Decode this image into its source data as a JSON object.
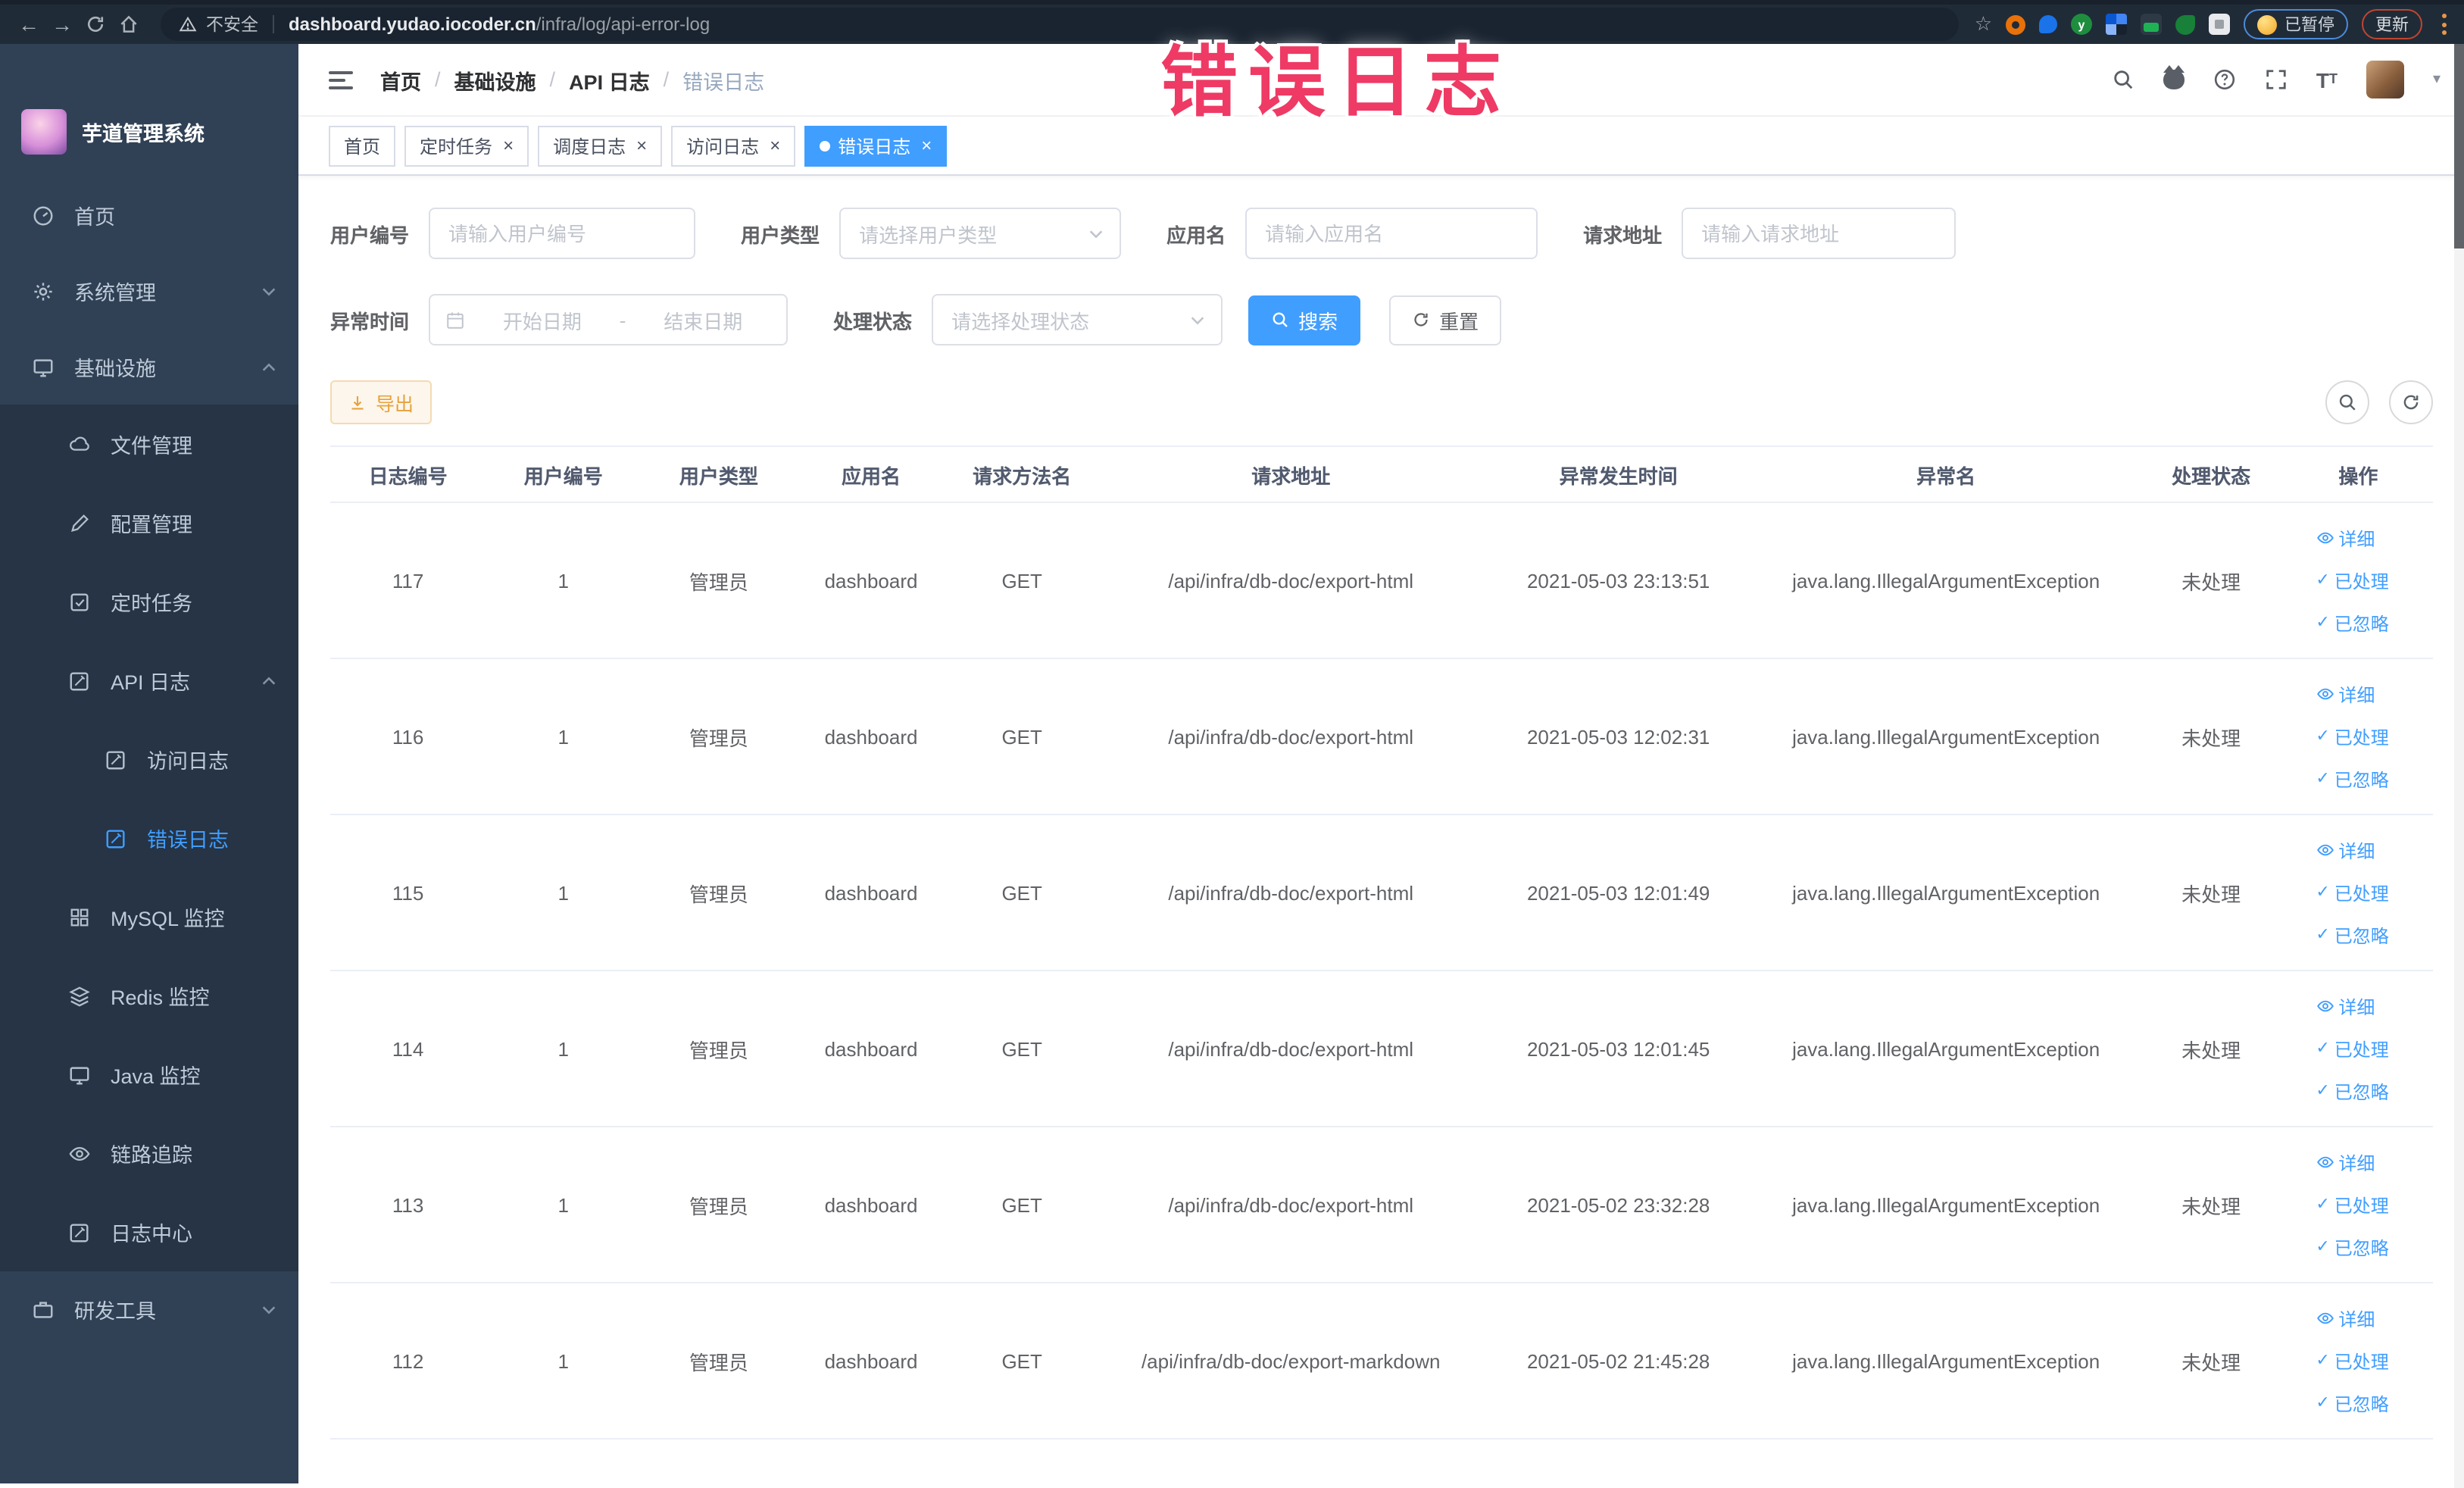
{
  "annotation": {
    "text": "错误日志"
  },
  "browser": {
    "security_label": "不安全",
    "url_host": "dashboard.yudao.iocoder.cn",
    "url_path": "/infra/log/api-error-log",
    "paused_button": "已暂停",
    "update_button": "更新"
  },
  "sidebar": {
    "title": "芋道管理系统",
    "items": [
      {
        "label": "首页"
      },
      {
        "label": "系统管理"
      },
      {
        "label": "基础设施"
      },
      {
        "label": "文件管理"
      },
      {
        "label": "配置管理"
      },
      {
        "label": "定时任务"
      },
      {
        "label": "API 日志"
      },
      {
        "label": "访问日志"
      },
      {
        "label": "错误日志",
        "active": true
      },
      {
        "label": "MySQL 监控"
      },
      {
        "label": "Redis 监控"
      },
      {
        "label": "Java 监控"
      },
      {
        "label": "链路追踪"
      },
      {
        "label": "日志中心"
      },
      {
        "label": "研发工具"
      }
    ]
  },
  "header": {
    "breadcrumb": [
      "首页",
      "基础设施",
      "API 日志",
      "错误日志"
    ]
  },
  "tabs": [
    {
      "label": "首页",
      "closable": false,
      "active": false
    },
    {
      "label": "定时任务",
      "closable": true,
      "active": false
    },
    {
      "label": "调度日志",
      "closable": true,
      "active": false
    },
    {
      "label": "访问日志",
      "closable": true,
      "active": false
    },
    {
      "label": "错误日志",
      "closable": true,
      "active": true
    }
  ],
  "filters": {
    "user_id": {
      "label": "用户编号",
      "placeholder": "请输入用户编号"
    },
    "user_type": {
      "label": "用户类型",
      "placeholder": "请选择用户类型"
    },
    "app_name": {
      "label": "应用名",
      "placeholder": "请输入应用名"
    },
    "request_url": {
      "label": "请求地址",
      "placeholder": "请输入请求地址"
    },
    "exception_time": {
      "label": "异常时间",
      "start_placeholder": "开始日期",
      "separator": "-",
      "end_placeholder": "结束日期"
    },
    "process_status": {
      "label": "处理状态",
      "placeholder": "请选择处理状态"
    },
    "search_button": "搜索",
    "reset_button": "重置"
  },
  "toolbar": {
    "export_button": "导出"
  },
  "table": {
    "columns": [
      "日志编号",
      "用户编号",
      "用户类型",
      "应用名",
      "请求方法名",
      "请求地址",
      "异常发生时间",
      "异常名",
      "处理状态",
      "操作"
    ],
    "actions": [
      "详细",
      "已处理",
      "已忽略"
    ],
    "rows": [
      {
        "id": "117",
        "user_id": "1",
        "user_type": "管理员",
        "app": "dashboard",
        "method": "GET",
        "url": "/api/infra/db-doc/export-html",
        "time": "2021-05-03 23:13:51",
        "exception": "java.lang.IllegalArgumentException",
        "status": "未处理"
      },
      {
        "id": "116",
        "user_id": "1",
        "user_type": "管理员",
        "app": "dashboard",
        "method": "GET",
        "url": "/api/infra/db-doc/export-html",
        "time": "2021-05-03 12:02:31",
        "exception": "java.lang.IllegalArgumentException",
        "status": "未处理"
      },
      {
        "id": "115",
        "user_id": "1",
        "user_type": "管理员",
        "app": "dashboard",
        "method": "GET",
        "url": "/api/infra/db-doc/export-html",
        "time": "2021-05-03 12:01:49",
        "exception": "java.lang.IllegalArgumentException",
        "status": "未处理"
      },
      {
        "id": "114",
        "user_id": "1",
        "user_type": "管理员",
        "app": "dashboard",
        "method": "GET",
        "url": "/api/infra/db-doc/export-html",
        "time": "2021-05-03 12:01:45",
        "exception": "java.lang.IllegalArgumentException",
        "status": "未处理"
      },
      {
        "id": "113",
        "user_id": "1",
        "user_type": "管理员",
        "app": "dashboard",
        "method": "GET",
        "url": "/api/infra/db-doc/export-html",
        "time": "2021-05-02 23:32:28",
        "exception": "java.lang.IllegalArgumentException",
        "status": "未处理"
      },
      {
        "id": "112",
        "user_id": "1",
        "user_type": "管理员",
        "app": "dashboard",
        "method": "GET",
        "url": "/api/infra/db-doc/export-markdown",
        "time": "2021-05-02 21:45:28",
        "exception": "java.lang.IllegalArgumentException",
        "status": "未处理"
      }
    ]
  },
  "colors": {
    "primary": "#409eff",
    "sidebar_bg": "#304156",
    "submenu_bg": "#263445",
    "warning": "#e6a23c",
    "annotation_pink": "#ee3a64",
    "chrome_bar": "#202b38"
  }
}
